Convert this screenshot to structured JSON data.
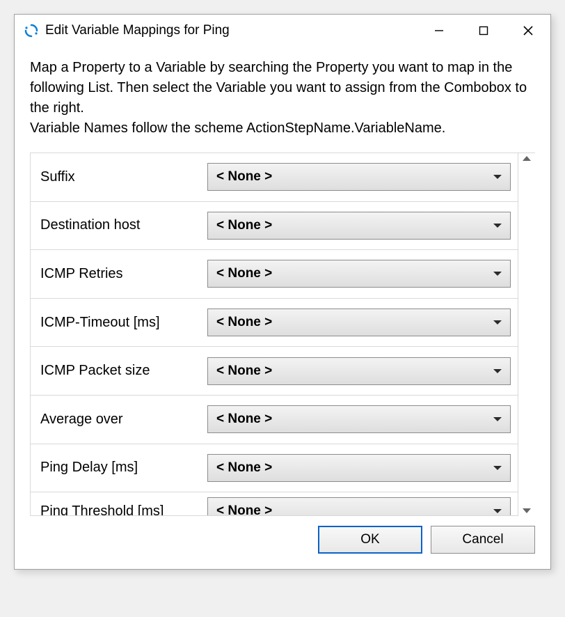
{
  "window": {
    "title": "Edit Variable Mappings for Ping"
  },
  "instructions": {
    "line1": "Map a Property to a Variable by searching the Property you want to map in the following List. Then select the Variable you want to assign from the Combobox to the right.",
    "line2": "Variable Names follow the scheme ActionStepName.VariableName."
  },
  "combo_default": "< None >",
  "properties": [
    {
      "label": "Suffix",
      "value": "< None >"
    },
    {
      "label": "Destination host",
      "value": "< None >"
    },
    {
      "label": "ICMP Retries",
      "value": "< None >"
    },
    {
      "label": "ICMP-Timeout [ms]",
      "value": "< None >"
    },
    {
      "label": "ICMP Packet size",
      "value": "< None >"
    },
    {
      "label": "Average over",
      "value": "< None >"
    },
    {
      "label": "Ping Delay [ms]",
      "value": "< None >"
    },
    {
      "label": "Ping Threshold [ms]",
      "value": "< None >"
    }
  ],
  "buttons": {
    "ok": "OK",
    "cancel": "Cancel"
  }
}
